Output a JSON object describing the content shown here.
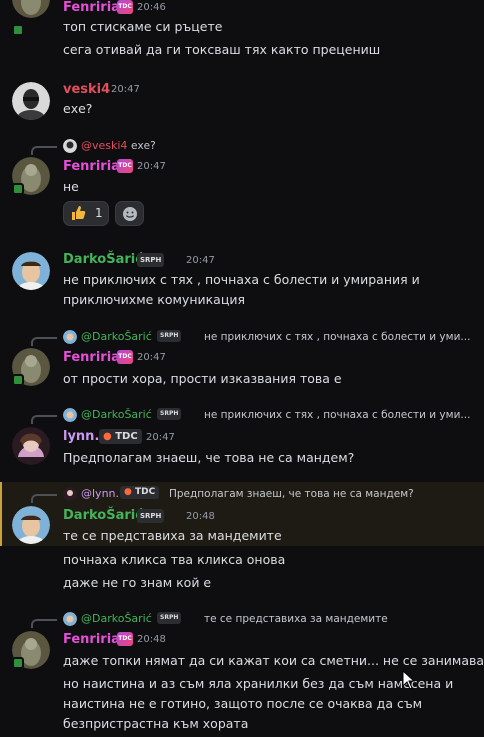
{
  "colors": {
    "background": "#0e0e10",
    "fenriria": "#e64fd8",
    "veski4": "#e0505c",
    "darko": "#45b35a",
    "lynn": "#c99af0",
    "timestamp": "#949ba4",
    "highlight": "#1e1b14"
  },
  "messages": [
    {
      "name": "Fenriria",
      "time": "20:46",
      "lines": [
        "топ стискаме си ръцете",
        "сега отивай да ги токсваш тях както прецениш"
      ]
    },
    {
      "name": "veski4",
      "time": "20:47",
      "lines": [
        "ехе?"
      ]
    },
    {
      "reply": {
        "name": "@veski4",
        "text": "ехе?"
      },
      "name": "Fenriria",
      "time": "20:47",
      "lines": [
        "не"
      ],
      "reaction": {
        "emoji": "thumbs-up",
        "count": "1"
      }
    },
    {
      "name": "DarkoŠarić",
      "badge": "SRPH",
      "time": "20:47",
      "lines": [
        "не приключих с тях , почнаха с болести и умирания и",
        "приключихме комуникация"
      ]
    },
    {
      "reply": {
        "name": "@DarkoŠarić",
        "badge": "SRPH",
        "text": "не приключих с тях , почнаха с болести и уми..."
      },
      "name": "Fenriria",
      "time": "20:47",
      "lines": [
        "от прости хора, прости изказвания това е"
      ]
    },
    {
      "reply": {
        "name": "@DarkoŠarić",
        "badge": "SRPH",
        "text": "не приключих с тях , почнаха с болести и уми..."
      },
      "name": "lynn.",
      "tag": "TDC",
      "time": "20:47",
      "lines": [
        "Предполагам знаеш, че това не са мандем?"
      ]
    },
    {
      "reply": {
        "name": "@lynn.",
        "tag": "TDC",
        "text": "Предполагам знаеш, че това не са мандем?"
      },
      "name": "DarkoŠarić",
      "badge": "SRPH",
      "time": "20:48",
      "lines": [
        "те се представиха за мандемите",
        "почнаха кликса тва кликса онова",
        "даже не го знам кой е"
      ]
    },
    {
      "reply": {
        "name": "@DarkoŠarić",
        "badge": "SRPH",
        "text": "те се представиха за мандемите"
      },
      "name": "Fenriria",
      "time": "20:48",
      "lines": [
        "даже топки нямат да си кажат кои са сметни... не се занимавай",
        "но наистина и аз съм яла хранилки без да съм намесена и",
        "наистина не е готино, защото после се очаква да съм",
        "безпристрастна към хората"
      ]
    }
  ],
  "badges": {
    "tdc_small": "TDC",
    "srph": "SRPH"
  }
}
